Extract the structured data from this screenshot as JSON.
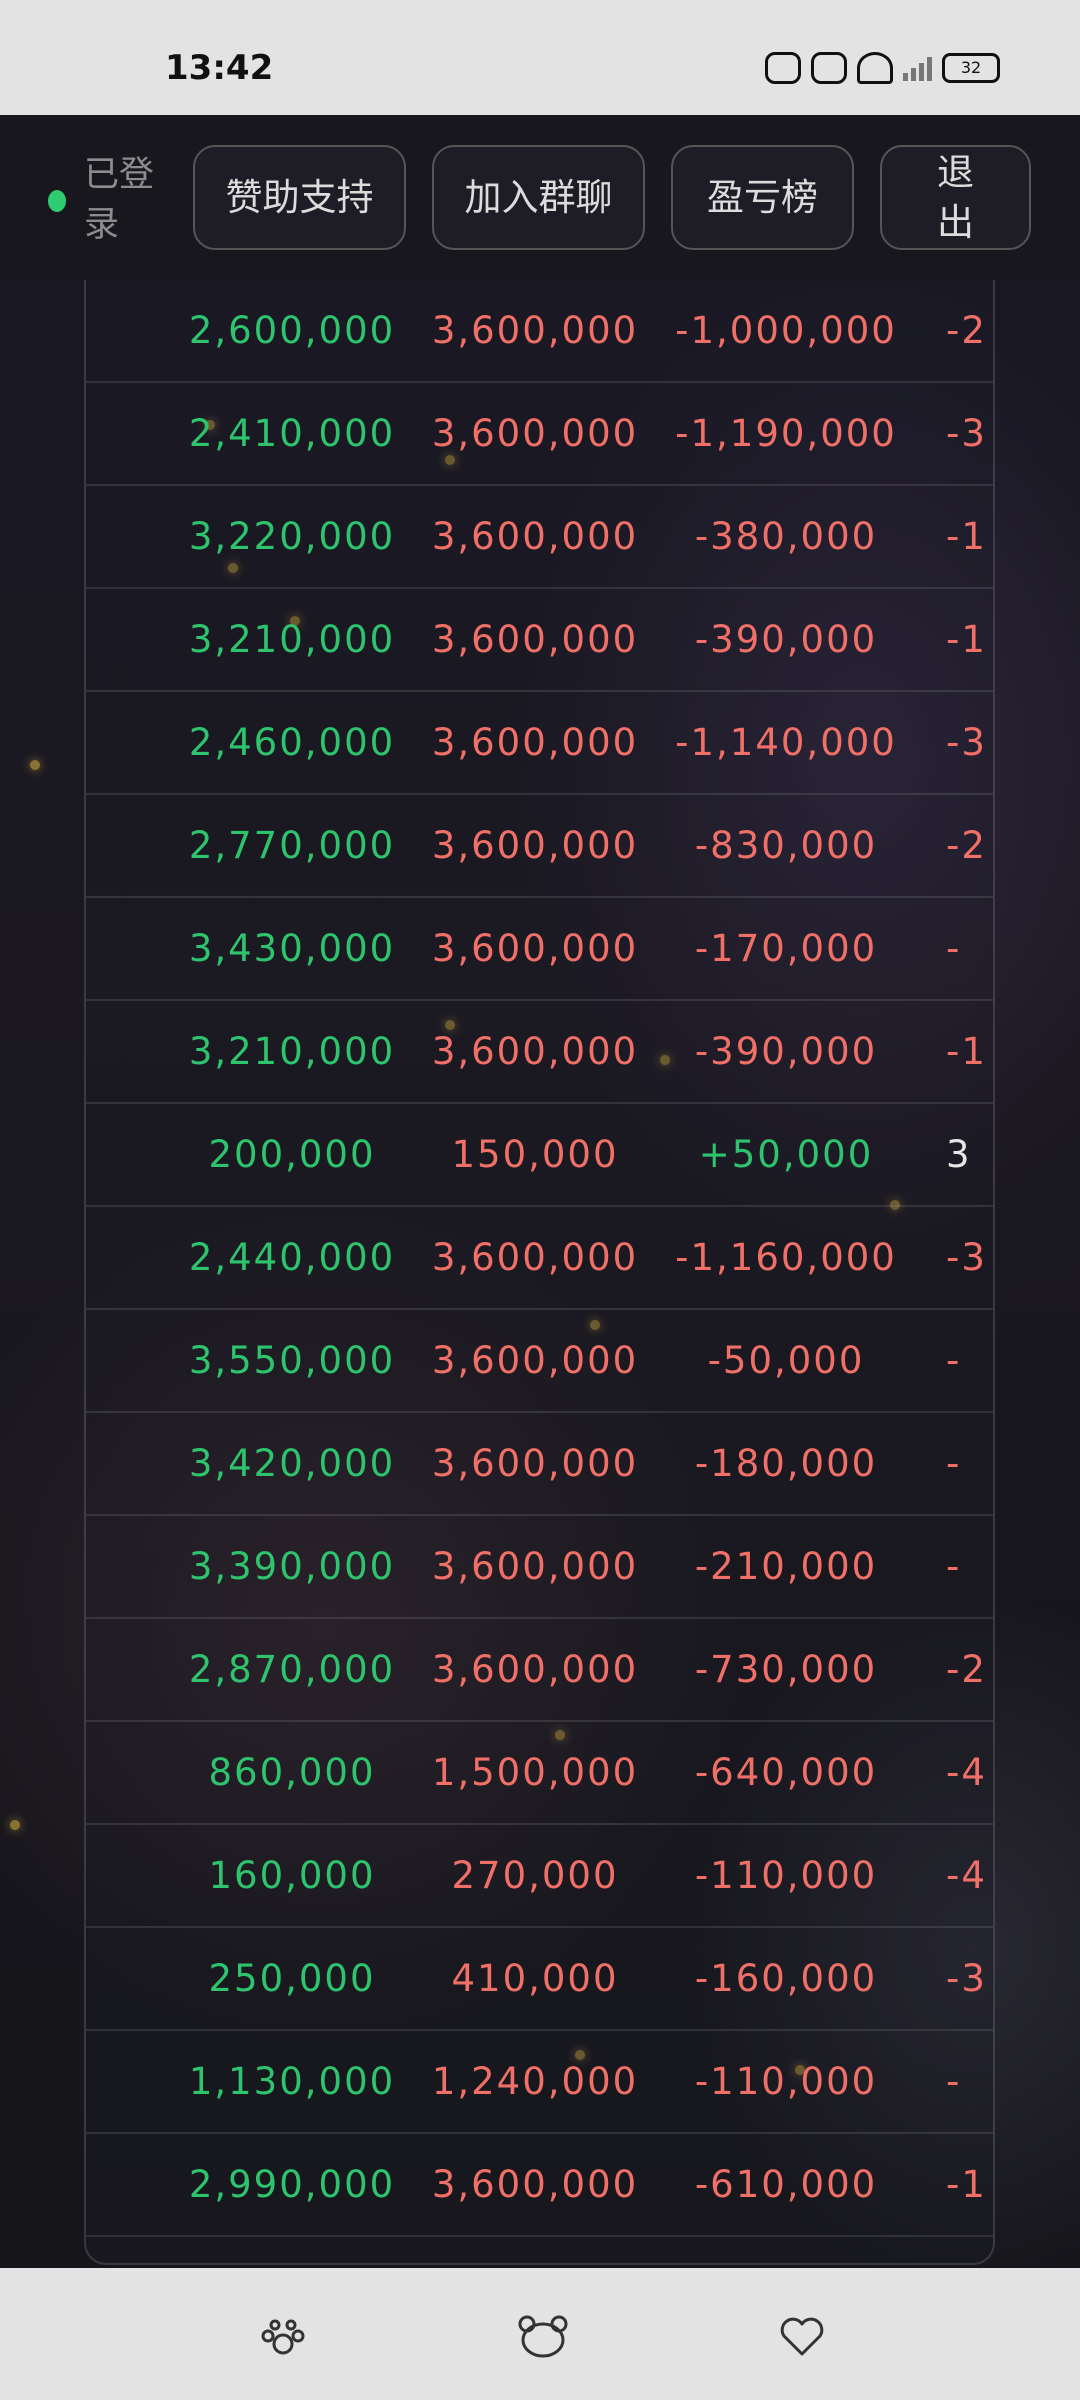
{
  "status_bar": {
    "time": "13:42",
    "battery": "32"
  },
  "header": {
    "login_status": "已登录",
    "buttons": [
      "赞助支持",
      "加入群聊",
      "盈亏榜",
      "退出"
    ]
  },
  "table": {
    "rows": [
      {
        "a": "2,600,000",
        "b": "3,600,000",
        "c": "-1,000,000",
        "d": "-2",
        "positive": false
      },
      {
        "a": "2,410,000",
        "b": "3,600,000",
        "c": "-1,190,000",
        "d": "-3",
        "positive": false
      },
      {
        "a": "3,220,000",
        "b": "3,600,000",
        "c": "-380,000",
        "d": "-1",
        "positive": false
      },
      {
        "a": "3,210,000",
        "b": "3,600,000",
        "c": "-390,000",
        "d": "-1",
        "positive": false
      },
      {
        "a": "2,460,000",
        "b": "3,600,000",
        "c": "-1,140,000",
        "d": "-3",
        "positive": false
      },
      {
        "a": "2,770,000",
        "b": "3,600,000",
        "c": "-830,000",
        "d": "-2",
        "positive": false
      },
      {
        "a": "3,430,000",
        "b": "3,600,000",
        "c": "-170,000",
        "d": "-",
        "positive": false
      },
      {
        "a": "3,210,000",
        "b": "3,600,000",
        "c": "-390,000",
        "d": "-1",
        "positive": false
      },
      {
        "a": "200,000",
        "b": "150,000",
        "c": "+50,000",
        "d": "3",
        "positive": true
      },
      {
        "a": "2,440,000",
        "b": "3,600,000",
        "c": "-1,160,000",
        "d": "-3",
        "positive": false
      },
      {
        "a": "3,550,000",
        "b": "3,600,000",
        "c": "-50,000",
        "d": "-",
        "positive": false
      },
      {
        "a": "3,420,000",
        "b": "3,600,000",
        "c": "-180,000",
        "d": "-",
        "positive": false
      },
      {
        "a": "3,390,000",
        "b": "3,600,000",
        "c": "-210,000",
        "d": "-",
        "positive": false
      },
      {
        "a": "2,870,000",
        "b": "3,600,000",
        "c": "-730,000",
        "d": "-2",
        "positive": false
      },
      {
        "a": "860,000",
        "b": "1,500,000",
        "c": "-640,000",
        "d": "-4",
        "positive": false
      },
      {
        "a": "160,000",
        "b": "270,000",
        "c": "-110,000",
        "d": "-4",
        "positive": false
      },
      {
        "a": "250,000",
        "b": "410,000",
        "c": "-160,000",
        "d": "-3",
        "positive": false
      },
      {
        "a": "1,130,000",
        "b": "1,240,000",
        "c": "-110,000",
        "d": "-",
        "positive": false
      },
      {
        "a": "2,990,000",
        "b": "3,600,000",
        "c": "-610,000",
        "d": "-1",
        "positive": false
      }
    ]
  },
  "bottom_nav": {
    "icons": [
      "paw-icon",
      "bear-icon",
      "heart-icon"
    ]
  }
}
